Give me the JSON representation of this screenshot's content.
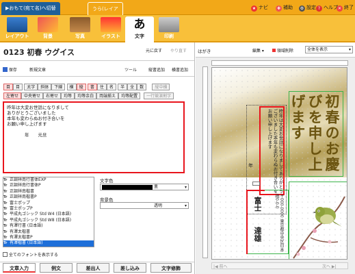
{
  "tabs": {
    "front": "▶おもて(宛て名)へ切替",
    "back": "うら(レイアウト)"
  },
  "toplinks": [
    "ナビ",
    "補助",
    "設定",
    "ヘルプ",
    "終了"
  ],
  "toolbar": [
    "レイアウト",
    "背景",
    "写真",
    "イラスト",
    "文字",
    "印刷"
  ],
  "doc": {
    "title": "0123 初春 ウグイス",
    "undo": "元に戻す",
    "redo": "やり直す",
    "save": "保存",
    "new": "新規文章",
    "tools": "ツール",
    "vadd": "縦書追加",
    "hadd": "横書追加"
  },
  "fmt": {
    "row1": [
      "太字",
      "斜体",
      "下線",
      "横",
      "縦",
      "書",
      "住",
      "名",
      "半",
      "全",
      "数"
    ],
    "row1_extra": "縦中横",
    "row2": [
      "左寄せ",
      "中央寄せ",
      "右寄せ",
      "均等",
      "均等余白",
      "両端揃え",
      "均等配置"
    ],
    "row2_extra": "一行競演割字"
  },
  "text": [
    "昨年は大変お世話になりまして",
    "ありがとうございました",
    "本年も変わらぬお付き合いを",
    "お願い申し上げます",
    "",
    "　　　　年　　元旦"
  ],
  "fonts": [
    "正調祥南行書体EXP",
    "正調祥南行書体P",
    "正調祥南楷書",
    "正調祥南楷書P",
    "富士ポップ",
    "富士ポップP",
    "平成丸ゴシック Std W4 (日本語)",
    "平成丸ゴシック Std W8 (日本語)",
    "有澤行書 (日本語)",
    "有澤太楷書",
    "有澤太楷書P",
    "有澤楷書 (日本語)"
  ],
  "color": {
    "label": "文字色",
    "value": "黒"
  },
  "bg": {
    "label": "背景色",
    "value": "透明"
  },
  "allfonts": "全てのフォントを表示する",
  "bottomtabs": [
    "文章入力",
    "例文",
    "差出人",
    "差し込み",
    "文字修飾"
  ],
  "right": {
    "title": "はがき",
    "edit": "編集",
    "display": "領域削除",
    "zoom": "全体を表示",
    "prev": "前へ",
    "next": "次へ"
  },
  "card": {
    "greeting": "初春のお慶びを申し上げます",
    "body": "昨年は大変お世話になりましてありがとうございました本年も変わらぬお付き合いをお願い申し上げます",
    "year": "年",
    "address": "富士",
    "name": "達雄"
  }
}
